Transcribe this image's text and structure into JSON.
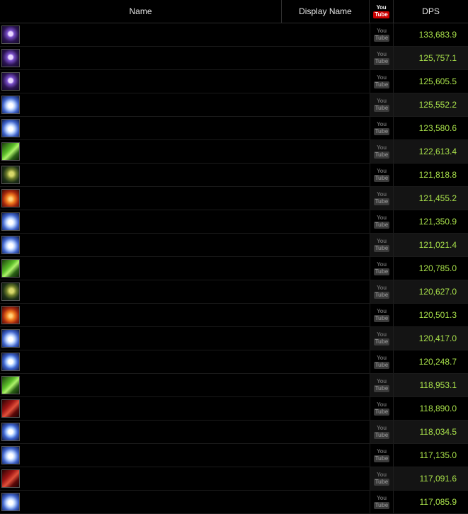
{
  "header": {
    "name": "Name",
    "display_name": "Display Name",
    "youtube_you": "You",
    "youtube_tube": "Tube",
    "dps": "DPS"
  },
  "rows": [
    {
      "icon": "shadow-icon",
      "dps": "133,683.9"
    },
    {
      "icon": "shadow-icon",
      "dps": "125,757.1"
    },
    {
      "icon": "shadow-icon",
      "dps": "125,605.5"
    },
    {
      "icon": "holy-light-icon",
      "dps": "125,552.2"
    },
    {
      "icon": "holy-light-icon",
      "dps": "123,580.6"
    },
    {
      "icon": "poison-blade-icon",
      "dps": "122,613.4"
    },
    {
      "icon": "plague-skull-icon",
      "dps": "121,818.8"
    },
    {
      "icon": "fire-axe-icon",
      "dps": "121,455.2"
    },
    {
      "icon": "holy-light-icon",
      "dps": "121,350.9"
    },
    {
      "icon": "holy-light-icon",
      "dps": "121,021.4"
    },
    {
      "icon": "poison-blade-icon",
      "dps": "120,785.0"
    },
    {
      "icon": "plague-skull-icon",
      "dps": "120,627.0"
    },
    {
      "icon": "fire-axe-icon",
      "dps": "120,501.3"
    },
    {
      "icon": "holy-light-icon",
      "dps": "120,417.0"
    },
    {
      "icon": "frost-skull-icon",
      "dps": "120,248.7"
    },
    {
      "icon": "poison-blade-icon",
      "dps": "118,953.1"
    },
    {
      "icon": "blood-scythe-icon",
      "dps": "118,890.0"
    },
    {
      "icon": "frost-skull-icon",
      "dps": "118,034.5"
    },
    {
      "icon": "holy-light-icon",
      "dps": "117,135.0"
    },
    {
      "icon": "blood-scythe-icon",
      "dps": "117,091.6"
    },
    {
      "icon": "holy-light-icon",
      "dps": "117,085.9"
    }
  ],
  "colors": {
    "background": "#000000",
    "dps_text": "#a8e04a",
    "header_text": "#e8e8e8"
  }
}
